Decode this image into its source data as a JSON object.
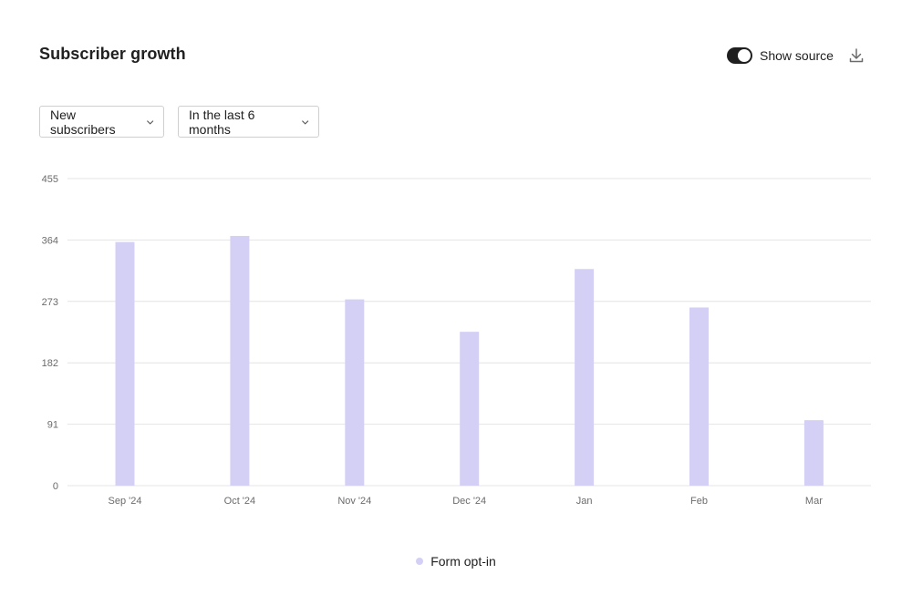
{
  "header": {
    "title": "Subscriber growth",
    "show_source_label": "Show source",
    "show_source_on": true
  },
  "filters": {
    "metric": "New subscribers",
    "range": "In the last 6 months"
  },
  "icons": {
    "download": "download-icon",
    "chevron": "chevron-down-icon"
  },
  "colors": {
    "bar": "#d4d0f5",
    "grid": "#e4e4e4",
    "toggle": "#1f1f1f"
  },
  "chart_data": {
    "type": "bar",
    "categories": [
      "Sep '24",
      "Oct '24",
      "Nov '24",
      "Dec '24",
      "Jan",
      "Feb",
      "Mar"
    ],
    "series": [
      {
        "name": "Form opt-in",
        "values": [
          361,
          370,
          276,
          228,
          321,
          264,
          97
        ]
      }
    ],
    "yticks": [
      0,
      91,
      182,
      273,
      364,
      455
    ],
    "ylim": [
      0,
      455
    ],
    "grid": true,
    "legend_position": "bottom-center"
  }
}
